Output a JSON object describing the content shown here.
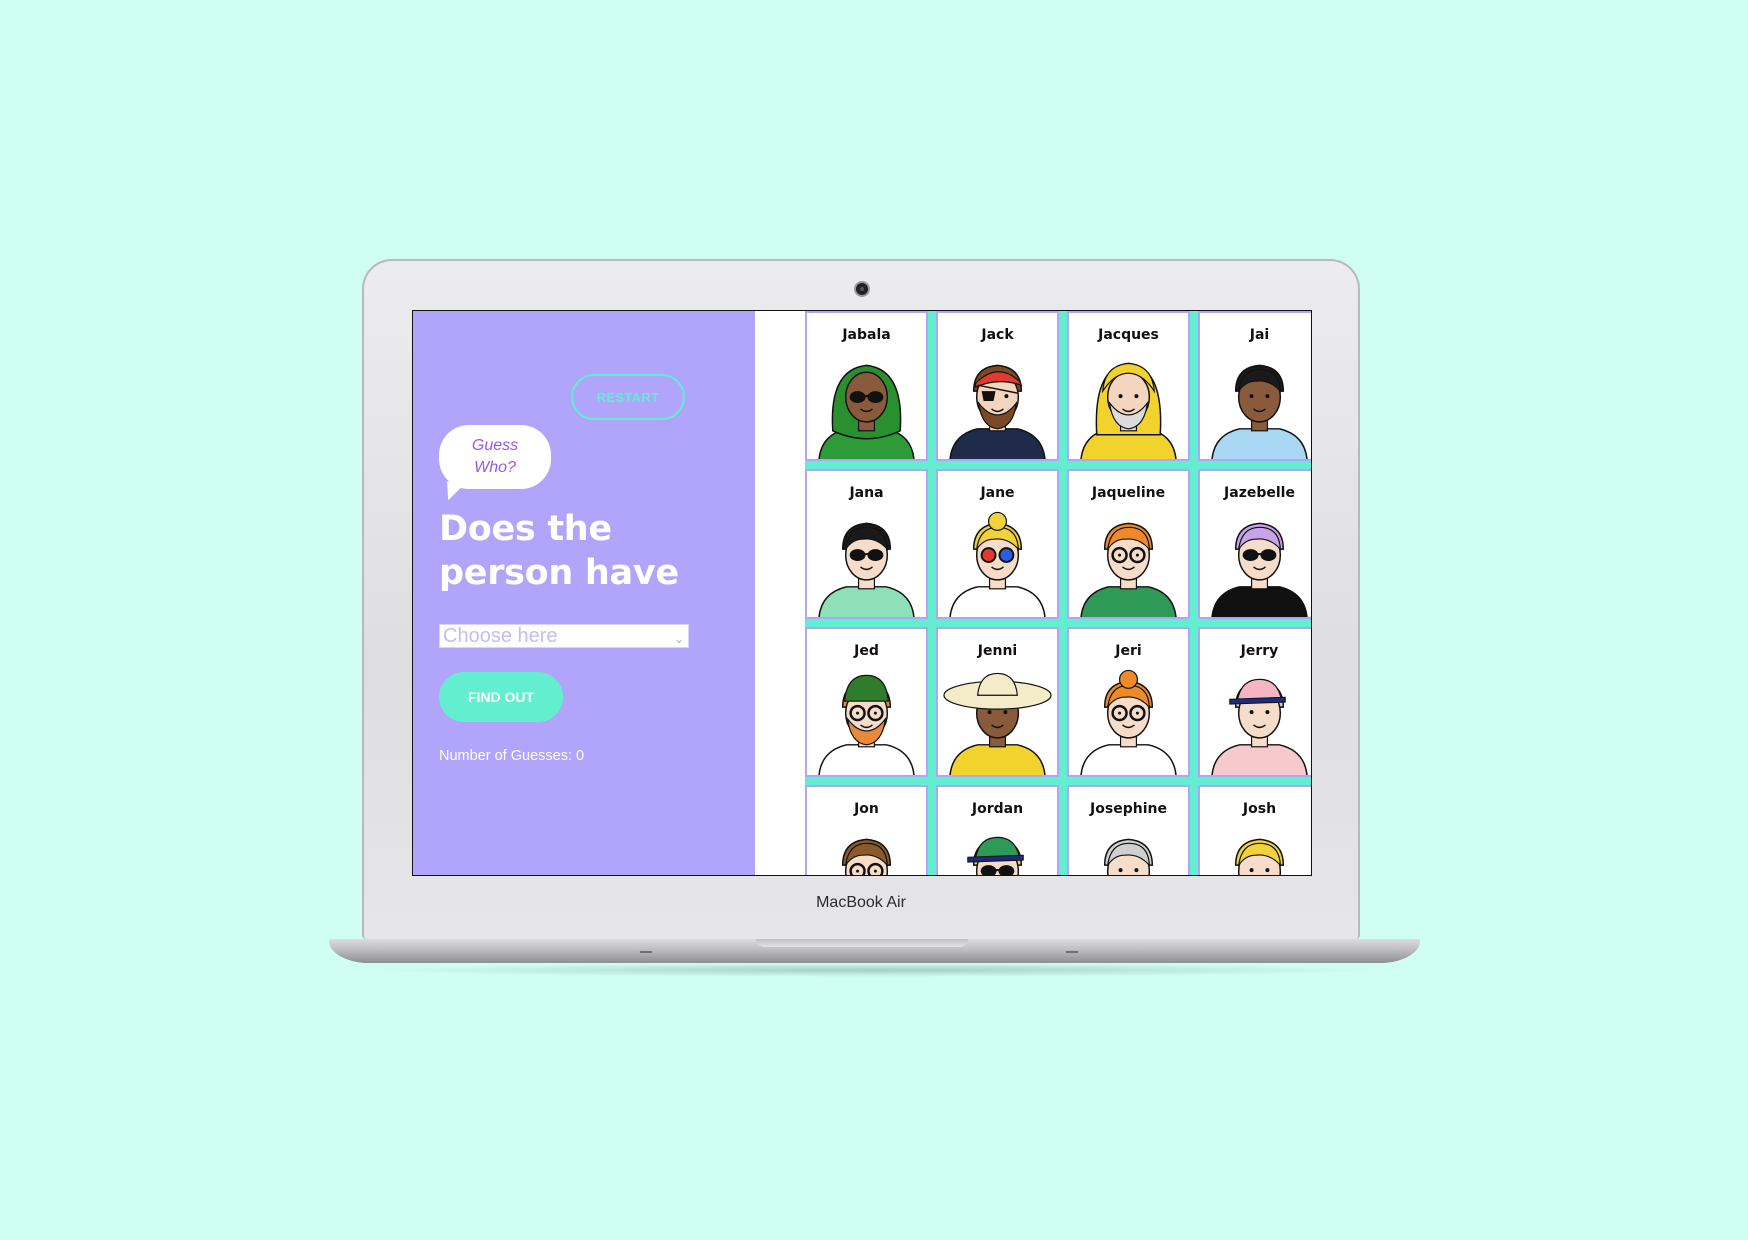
{
  "laptop": {
    "brand_label": "MacBook Air"
  },
  "sidebar": {
    "restart_label": "RESTART",
    "bubble_text": "Guess Who?",
    "question": "Does the person have",
    "select_placeholder": "Choose here",
    "find_out_label": "FIND OUT",
    "guesses_label": "Number of Guesses: 0"
  },
  "board": {
    "cards": [
      {
        "name": "Jabala",
        "skin": "#8a5a3c",
        "hair": "#2a8f2e",
        "shirt": "#2d9b37",
        "eyewear": "sunglasses",
        "hat": "hijab"
      },
      {
        "name": "Jack",
        "skin": "#f3d4bd",
        "hair": "#7a4a25",
        "shirt": "#1e2b4a",
        "eyewear": "eyepatch",
        "hat": "bandana"
      },
      {
        "name": "Jacques",
        "skin": "#f4d6c0",
        "hair": "#cfcfcf",
        "shirt": "#f2d22c",
        "eyewear": "none",
        "hat": "raincoat"
      },
      {
        "name": "Jai",
        "skin": "#8a5a3c",
        "hair": "#1a1a1a",
        "shirt": "#a9d8f4",
        "eyewear": "none",
        "hat": "none"
      },
      {
        "name": "Jana",
        "skin": "#f6ddc9",
        "hair": "#1a1a1a",
        "shirt": "#8ee0b8",
        "eyewear": "sunglasses",
        "hat": "none"
      },
      {
        "name": "Jane",
        "skin": "#f6ddc9",
        "hair": "#f1d23a",
        "shirt": "#ffffff",
        "eyewear": "3d-glasses",
        "hat": "bun"
      },
      {
        "name": "Jaqueline",
        "skin": "#f6ddc9",
        "hair": "#ef8a2a",
        "shirt": "#2f9a55",
        "eyewear": "glasses",
        "hat": "none"
      },
      {
        "name": "Jazebelle",
        "skin": "#f6ddc9",
        "hair": "#c7a3e8",
        "shirt": "#111111",
        "eyewear": "sunglasses",
        "hat": "none"
      },
      {
        "name": "Jed",
        "skin": "#f6ddc9",
        "hair": "#e88a3a",
        "shirt": "#ffffff",
        "eyewear": "glasses",
        "hat": "beanie"
      },
      {
        "name": "Jenni",
        "skin": "#8a5a3c",
        "hair": "#1a1a1a",
        "shirt": "#f2d22c",
        "eyewear": "none",
        "hat": "sunhat"
      },
      {
        "name": "Jeri",
        "skin": "#f6ddc9",
        "hair": "#ef8a2a",
        "shirt": "#ffffff",
        "eyewear": "glasses",
        "hat": "bun"
      },
      {
        "name": "Jerry",
        "skin": "#f6ddc9",
        "hair": "#cfcfcf",
        "shirt": "#f7c9cd",
        "eyewear": "none",
        "hat": "cap"
      },
      {
        "name": "Jon",
        "skin": "#f6ddc9",
        "hair": "#8a5a2b",
        "shirt": "#ffffff",
        "eyewear": "glasses",
        "hat": "none"
      },
      {
        "name": "Jordan",
        "skin": "#f6ddc9",
        "hair": "#f1d23a",
        "shirt": "#ffffff",
        "eyewear": "sunglasses",
        "hat": "cap"
      },
      {
        "name": "Josephine",
        "skin": "#f6ddc9",
        "hair": "#cfcfcf",
        "shirt": "#ffffff",
        "eyewear": "none",
        "hat": "none"
      },
      {
        "name": "Josh",
        "skin": "#f6ddc9",
        "hair": "#f1d23a",
        "shirt": "#ffffff",
        "eyewear": "none",
        "hat": "none"
      }
    ]
  }
}
